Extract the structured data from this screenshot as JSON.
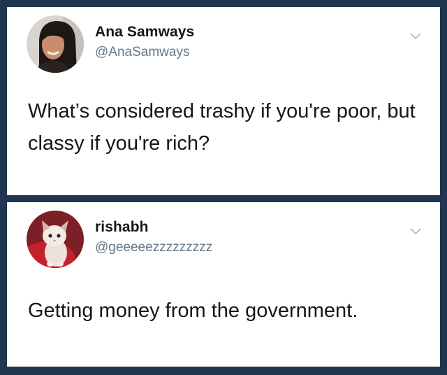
{
  "colors": {
    "background": "#1f3550",
    "card": "#ffffff",
    "name_text": "#14171a",
    "handle_text": "#657786",
    "body_text": "#14171a"
  },
  "tweets": [
    {
      "display_name": "Ana Samways",
      "handle": "@AnaSamways",
      "text": "What’s considered trashy if you're poor, but classy if you're rich?",
      "avatar_icon": "woman-portrait-avatar",
      "menu_icon": "chevron-down-icon"
    },
    {
      "display_name": "rishabh",
      "handle": "@geeeeezzzzzzzzz",
      "text": "Getting money from the government.",
      "avatar_icon": "kitten-portrait-avatar",
      "menu_icon": "chevron-down-icon"
    }
  ]
}
